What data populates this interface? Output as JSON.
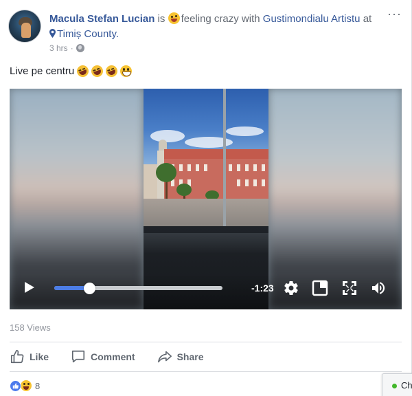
{
  "post": {
    "author": "Macula Stefan Lucian",
    "verb": "is",
    "feeling": "feeling crazy with",
    "tagged": "Gustimondialu Artistu",
    "at": "at",
    "location": "Timiș County.",
    "time": "3 hrs",
    "separator": "·",
    "text": "Live pe centru",
    "more_menu": "···"
  },
  "video": {
    "time_remaining": "-1:23",
    "progress": 0.21
  },
  "stats": {
    "views": "158 Views",
    "reaction_count": "8"
  },
  "actions": {
    "like": "Like",
    "comment": "Comment",
    "share": "Share"
  },
  "chat": {
    "label": "Ch"
  },
  "colors": {
    "link": "#365899",
    "meta": "#90949c",
    "progress": "#4c7de6"
  },
  "icons": [
    "feeling-crazy-emoji-icon",
    "location-pin-icon",
    "globe-icon",
    "rolling-laughing-emoji-icon",
    "grinning-emoji-icon",
    "play-icon",
    "settings-gear-icon",
    "picture-in-picture-icon",
    "fullscreen-icon",
    "volume-icon",
    "like-thumb-icon",
    "comment-icon",
    "share-icon",
    "like-reaction-icon",
    "haha-reaction-icon"
  ]
}
